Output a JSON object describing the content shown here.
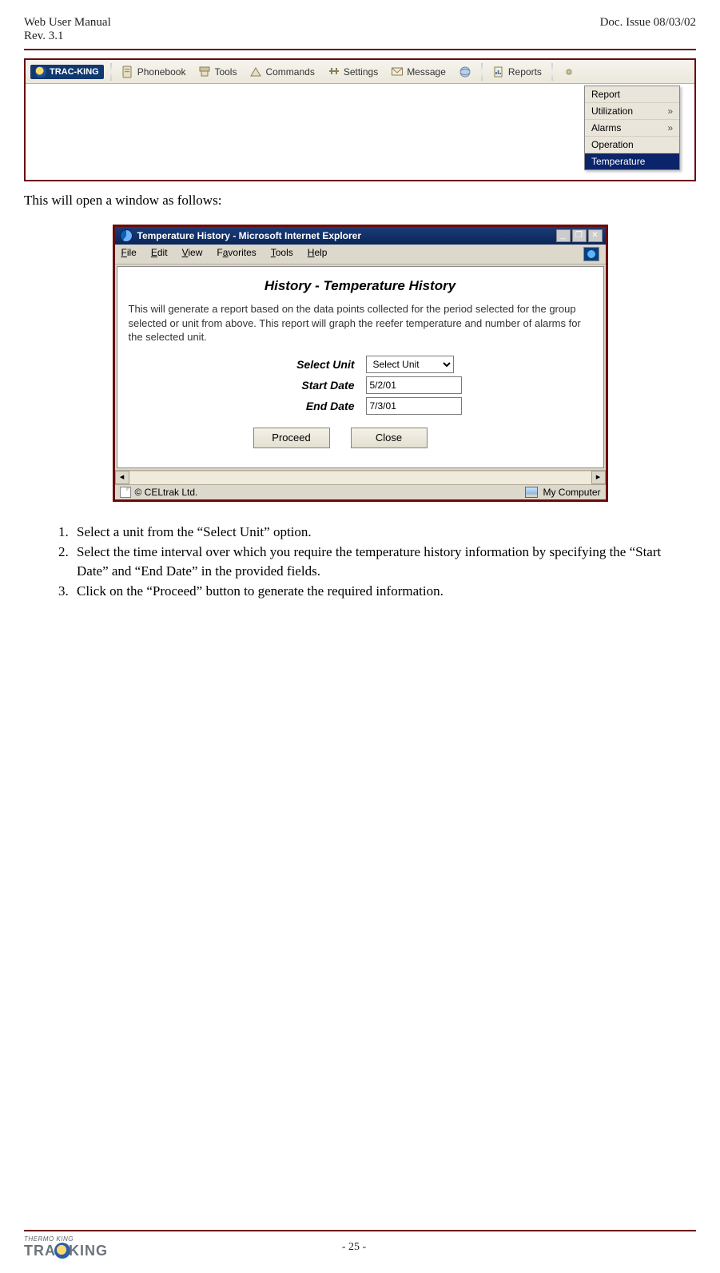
{
  "header": {
    "left_line1": "Web User Manual",
    "left_line2": "Rev. 3.1",
    "right": "Doc. Issue 08/03/02"
  },
  "toolbar": {
    "logo_text": "TRAC-KING",
    "items": [
      "Phonebook",
      "Tools",
      "Commands",
      "Settings",
      "Message",
      "Reports"
    ]
  },
  "dropdown": {
    "items": [
      {
        "label": "Report",
        "submenu": false,
        "selected": false
      },
      {
        "label": "Utilization",
        "submenu": true,
        "selected": false
      },
      {
        "label": "Alarms",
        "submenu": true,
        "selected": false
      },
      {
        "label": "Operation",
        "submenu": false,
        "selected": false
      },
      {
        "label": "Temperature",
        "submenu": false,
        "selected": true
      }
    ]
  },
  "intro_text": "This will open a window as follows:",
  "iewindow": {
    "title": "Temperature History - Microsoft Internet Explorer",
    "menus": [
      "File",
      "Edit",
      "View",
      "Favorites",
      "Tools",
      "Help"
    ],
    "heading": "History - Temperature History",
    "description": "This will generate a report based on the data points collected for the period selected for the group selected or unit from above. This report will graph the reefer temperature and number of alarms for the selected unit.",
    "form": {
      "select_unit_label": "Select Unit",
      "select_unit_value": "Select Unit",
      "start_date_label": "Start Date",
      "start_date_value": "5/2/01",
      "end_date_label": "End Date",
      "end_date_value": "7/3/01",
      "proceed_btn": "Proceed",
      "close_btn": "Close"
    },
    "status_left": "© CELtrak Ltd.",
    "status_right": "My Computer"
  },
  "steps": [
    "Select a unit from the “Select Unit” option.",
    "Select the time interval over which you require the temperature history information by specifying the “Start Date” and “End Date” in the provided fields.",
    "Click on the “Proceed” button to generate the required information."
  ],
  "footer": {
    "logo_small": "THERMO KING",
    "logo_big_left": "TRA",
    "logo_big_right": "KING",
    "page_number": "- 25 -"
  }
}
